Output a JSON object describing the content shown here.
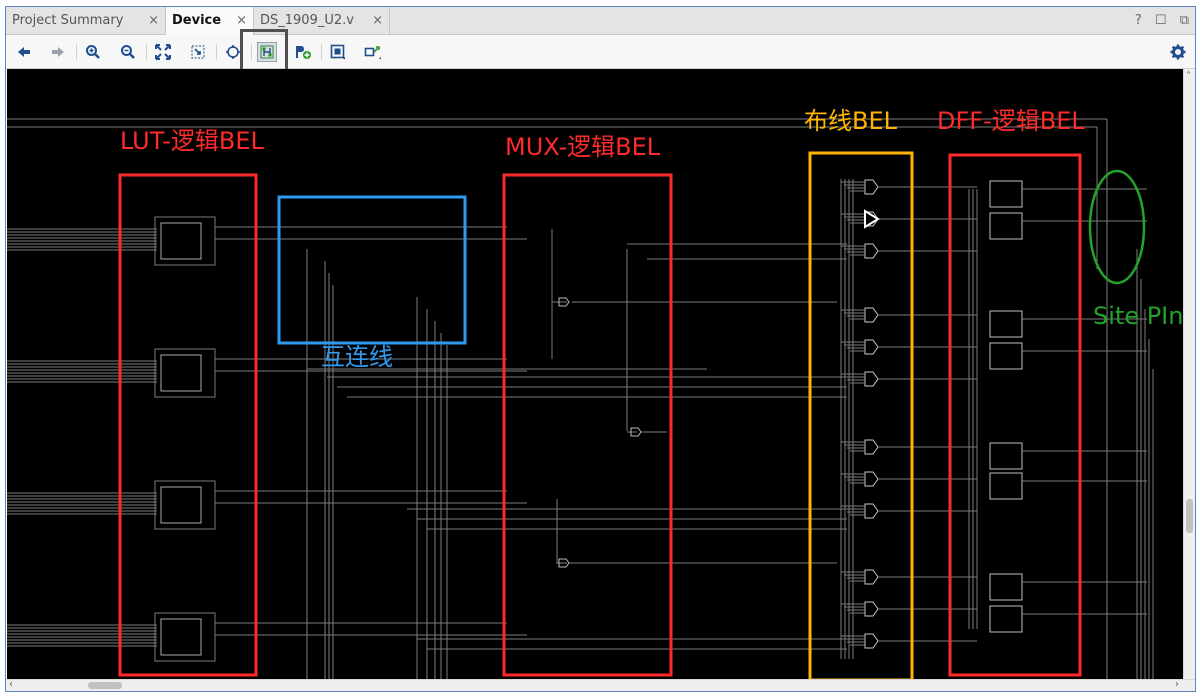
{
  "tabs": [
    {
      "label": "Project Summary",
      "active": false
    },
    {
      "label": "Device",
      "active": true
    },
    {
      "label": "DS_1909_U2.v",
      "active": false
    }
  ],
  "tab_close_glyph": "×",
  "window_controls": {
    "help": "?",
    "minimize": "☐",
    "restore": "⧉"
  },
  "toolbar": {
    "icons": [
      "back-icon",
      "forward-icon",
      "zoom-in-icon",
      "zoom-out-icon",
      "fit-icon",
      "zoom-selection-icon",
      "crosshair-icon",
      "routing-resources-icon",
      "add-pblock-icon",
      "draw-pblock-icon",
      "draw-region-icon"
    ],
    "settings_icon": "gear-icon"
  },
  "annotations": {
    "lut": "LUT-逻辑BEL",
    "interconnect": "互连线",
    "mux": "MUX-逻辑BEL",
    "routing": "布线BEL",
    "dff": "DFF-逻辑BEL",
    "site_pins": "Site PIns"
  },
  "colors": {
    "lut_box": "#ff2a2a",
    "interconnect_box": "#2f9bf0",
    "routing_box": "#ffb400",
    "site_pins": "#22a32a",
    "canvas_bg": "#000000",
    "wire": "#7c7c7c"
  }
}
